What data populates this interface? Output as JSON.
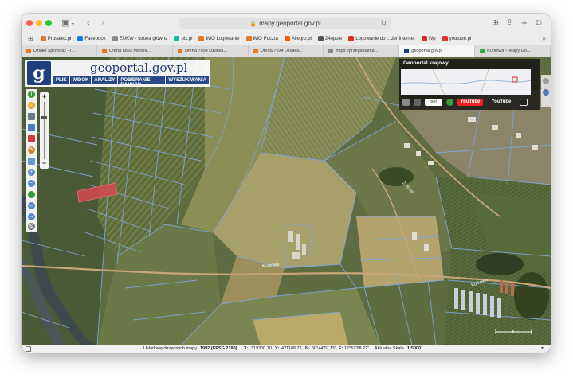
{
  "browser": {
    "address": "mapy.geoportal.gov.pl",
    "bookmarks": [
      {
        "label": "Prosalex.pl",
        "color": "#e87722"
      },
      {
        "label": "Facebook",
        "color": "#1877f2"
      },
      {
        "label": "EUKW - strona główna",
        "color": "#8a8a8a"
      },
      {
        "label": "olx.pl",
        "color": "#23b5a4"
      },
      {
        "label": "IMO Logowanie",
        "color": "#e87722"
      },
      {
        "label": "IMO Poczta",
        "color": "#e87722"
      },
      {
        "label": "Allegro.pl",
        "color": "#ff5a00"
      },
      {
        "label": "24opole",
        "color": "#555555"
      },
      {
        "label": "Logowanie do ...der internet",
        "color": "#d9301e"
      },
      {
        "label": "Wp",
        "color": "#d22f2a"
      },
      {
        "label": "youtube.pl",
        "color": "#e52d27"
      }
    ],
    "tabs": [
      {
        "label": "Działki Sprzedaż - I...",
        "color": "#e87722",
        "active": false
      },
      {
        "label": "Oferta 8893 Mieszk...",
        "color": "#e87722",
        "active": false
      },
      {
        "label": "Oferta 7034 Działka...",
        "color": "#e87722",
        "active": false
      },
      {
        "label": "Oferta 7034 Działka...",
        "color": "#e87722",
        "active": false
      },
      {
        "label": "https://przegladarka...",
        "color": "#888888",
        "active": false
      },
      {
        "label": "geoportal.gov.pl",
        "color": "#1f3f7c",
        "active": true
      },
      {
        "label": "Kurkowa – Mapy Go...",
        "color": "#34a853",
        "active": false
      }
    ]
  },
  "geoportal": {
    "logo_text": "geoportal.gov.pl",
    "logo_letter": "g",
    "menu": [
      "PLIK",
      "WIDOK",
      "ANALIZY",
      "POBIERANIE DANYCH",
      "WYSZUKIWANIA"
    ],
    "overview_title": "Geoportal krajowy",
    "overview_tools": [
      "pol",
      "YouTube",
      "YouTube"
    ]
  },
  "map": {
    "road_labels": [
      "Kurkowa",
      "Kurkowa",
      "Zielona"
    ]
  },
  "status": {
    "system_label": "Układ współrzędnych mapy",
    "system_value": "1992 (EPSG 2180)",
    "x_label": "X:",
    "x_value": "319300.10",
    "y_label": "Y:",
    "y_value": "421188.72",
    "n_label": "N:",
    "n_value": "50°44'07.15\"",
    "e_label": "E:",
    "e_value": "17°52'58.22\"",
    "scale_label": "Aktualna Skala",
    "scale_value": "1:5000"
  }
}
